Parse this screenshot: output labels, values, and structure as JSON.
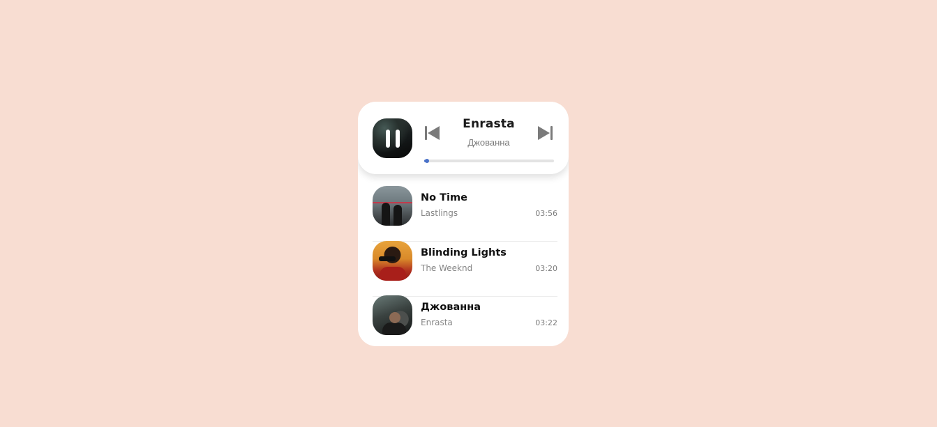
{
  "now_playing": {
    "title": "Enrasta",
    "artist": "Джованна",
    "progress": 0.02,
    "state": "playing",
    "icons": {
      "play_pause": "pause-icon",
      "previous": "skip-previous-icon",
      "next": "skip-next-icon"
    }
  },
  "tracks": [
    {
      "name": "No Time",
      "artist": "Lastlings",
      "duration": "03:56"
    },
    {
      "name": "Blinding Lights",
      "artist": "The Weeknd",
      "duration": "03:20"
    },
    {
      "name": "Джованна",
      "artist": "Enrasta",
      "duration": "03:22"
    }
  ],
  "colors": {
    "background": "#f8ddd2",
    "card": "#ffffff",
    "accent": "#4a72c9",
    "controls": "#7a7a7a"
  }
}
